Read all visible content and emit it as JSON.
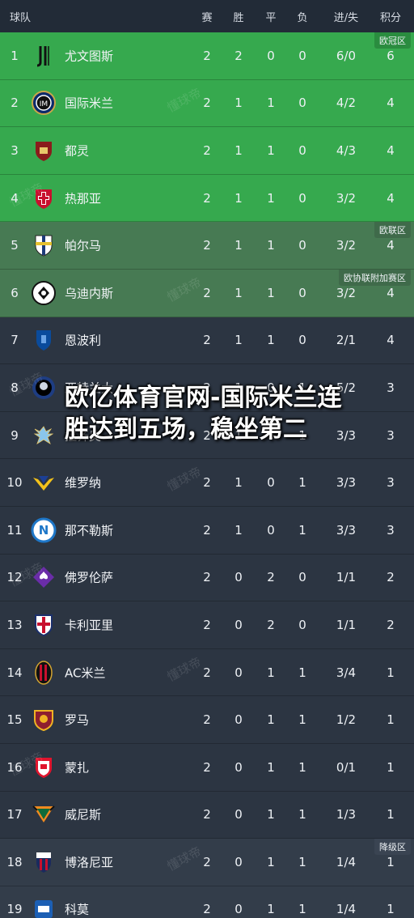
{
  "header": {
    "team": "球队",
    "played": "赛",
    "won": "胜",
    "draw": "平",
    "lost": "负",
    "goals": "进/失",
    "points": "积分"
  },
  "zones": {
    "cl": "欧冠区",
    "el": "欧联区",
    "ecl": "欧协联附加赛区",
    "rel": "降级区"
  },
  "watermark": "懂球帝",
  "overlay": {
    "title": "欧亿体育官网-国际米兰连胜达到五场，稳坐第二"
  },
  "colors": {
    "champions_league": "#36a94e",
    "europa": "#477a53",
    "background": "#2c3542",
    "header": "#222b37"
  },
  "rows": [
    {
      "rank": "1",
      "team": "尤文图斯",
      "icon": "juventus-badge-icon",
      "p": "2",
      "w": "2",
      "d": "0",
      "l": "0",
      "g": "6/0",
      "pts": "6",
      "zone": "cl"
    },
    {
      "rank": "2",
      "team": "国际米兰",
      "icon": "inter-badge-icon",
      "p": "2",
      "w": "1",
      "d": "1",
      "l": "0",
      "g": "4/2",
      "pts": "4",
      "zone": "cl"
    },
    {
      "rank": "3",
      "team": "都灵",
      "icon": "torino-badge-icon",
      "p": "2",
      "w": "1",
      "d": "1",
      "l": "0",
      "g": "4/3",
      "pts": "4",
      "zone": "cl"
    },
    {
      "rank": "4",
      "team": "热那亚",
      "icon": "genoa-badge-icon",
      "p": "2",
      "w": "1",
      "d": "1",
      "l": "0",
      "g": "3/2",
      "pts": "4",
      "zone": "cl"
    },
    {
      "rank": "5",
      "team": "帕尔马",
      "icon": "parma-badge-icon",
      "p": "2",
      "w": "1",
      "d": "1",
      "l": "0",
      "g": "3/2",
      "pts": "4",
      "zone": "el"
    },
    {
      "rank": "6",
      "team": "乌迪内斯",
      "icon": "udinese-badge-icon",
      "p": "2",
      "w": "1",
      "d": "1",
      "l": "0",
      "g": "3/2",
      "pts": "4",
      "zone": "ecl"
    },
    {
      "rank": "7",
      "team": "恩波利",
      "icon": "empoli-badge-icon",
      "p": "2",
      "w": "1",
      "d": "1",
      "l": "0",
      "g": "2/1",
      "pts": "4",
      "zone": ""
    },
    {
      "rank": "8",
      "team": "亚特兰大",
      "icon": "atalanta-badge-icon",
      "p": "2",
      "w": "1",
      "d": "0",
      "l": "1",
      "g": "5/2",
      "pts": "3",
      "zone": ""
    },
    {
      "rank": "9",
      "team": "拉齐奥",
      "icon": "lazio-badge-icon",
      "p": "2",
      "w": "1",
      "d": "0",
      "l": "1",
      "g": "3/3",
      "pts": "3",
      "zone": ""
    },
    {
      "rank": "10",
      "team": "维罗纳",
      "icon": "verona-badge-icon",
      "p": "2",
      "w": "1",
      "d": "0",
      "l": "1",
      "g": "3/3",
      "pts": "3",
      "zone": ""
    },
    {
      "rank": "11",
      "team": "那不勒斯",
      "icon": "napoli-badge-icon",
      "p": "2",
      "w": "1",
      "d": "0",
      "l": "1",
      "g": "3/3",
      "pts": "3",
      "zone": ""
    },
    {
      "rank": "12",
      "team": "佛罗伦萨",
      "icon": "fiorentina-badge-icon",
      "p": "2",
      "w": "0",
      "d": "2",
      "l": "0",
      "g": "1/1",
      "pts": "2",
      "zone": ""
    },
    {
      "rank": "13",
      "team": "卡利亚里",
      "icon": "cagliari-badge-icon",
      "p": "2",
      "w": "0",
      "d": "2",
      "l": "0",
      "g": "1/1",
      "pts": "2",
      "zone": ""
    },
    {
      "rank": "14",
      "team": "AC米兰",
      "icon": "acmilan-badge-icon",
      "p": "2",
      "w": "0",
      "d": "1",
      "l": "1",
      "g": "3/4",
      "pts": "1",
      "zone": ""
    },
    {
      "rank": "15",
      "team": "罗马",
      "icon": "roma-badge-icon",
      "p": "2",
      "w": "0",
      "d": "1",
      "l": "1",
      "g": "1/2",
      "pts": "1",
      "zone": ""
    },
    {
      "rank": "16",
      "team": "蒙扎",
      "icon": "monza-badge-icon",
      "p": "2",
      "w": "0",
      "d": "1",
      "l": "1",
      "g": "0/1",
      "pts": "1",
      "zone": ""
    },
    {
      "rank": "17",
      "team": "威尼斯",
      "icon": "venezia-badge-icon",
      "p": "2",
      "w": "0",
      "d": "1",
      "l": "1",
      "g": "1/3",
      "pts": "1",
      "zone": ""
    },
    {
      "rank": "18",
      "team": "博洛尼亚",
      "icon": "bologna-badge-icon",
      "p": "2",
      "w": "0",
      "d": "1",
      "l": "1",
      "g": "1/4",
      "pts": "1",
      "zone": "rel"
    },
    {
      "rank": "19",
      "team": "科莫",
      "icon": "como-badge-icon",
      "p": "2",
      "w": "0",
      "d": "1",
      "l": "1",
      "g": "1/4",
      "pts": "1",
      "zone": "rel"
    }
  ]
}
